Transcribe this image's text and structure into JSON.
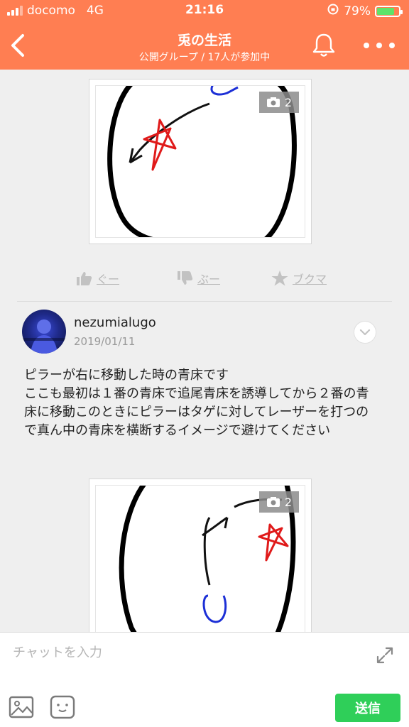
{
  "status_bar": {
    "carrier": "docomo",
    "network": "4G",
    "time": "21:16",
    "battery_percent": "79%",
    "battery_level": 0.79
  },
  "header": {
    "title": "兎の生活",
    "subtitle": "公開グループ / 17人が参加中",
    "back_icon": "chevron-left-icon",
    "bell_icon": "bell-icon",
    "more_icon": "more-dots-icon"
  },
  "post_top": {
    "image_count": "2",
    "camera_icon": "camera-icon"
  },
  "reactions": {
    "like_label": "ぐー",
    "dislike_label": "ぶー",
    "bookmark_label": "ブクマ"
  },
  "post": {
    "username": "nezumialugo",
    "date": "2019/01/11",
    "text_line1": "ピラーが右に移動した時の青床です",
    "text_line2": "ここも最初は１番の青床で追尾青床を誘導してから２番の青床に移動このときにピラーはタゲに対してレーザーを打つので真ん中の青床を横断するイメージで避けてください",
    "image_count": "2"
  },
  "composer": {
    "placeholder": "チャットを入力",
    "send_label": "送信"
  },
  "colors": {
    "accent": "#ff7e52",
    "send": "#2fcf59",
    "status_green": "#5ee36a"
  }
}
